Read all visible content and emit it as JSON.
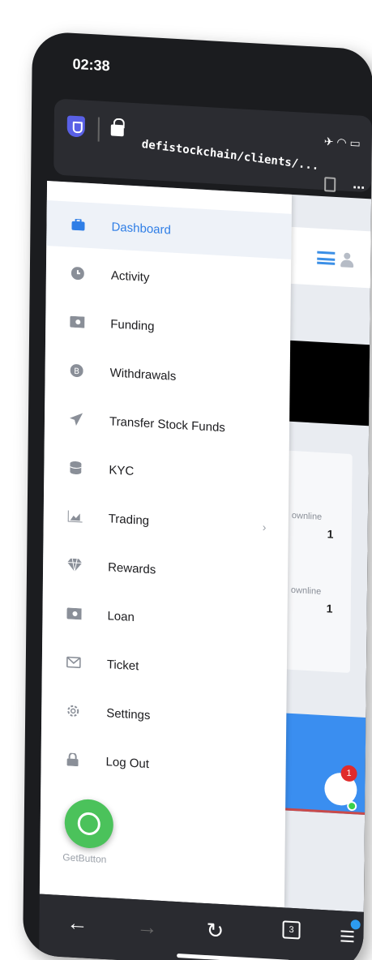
{
  "status_bar": {
    "time": "02:38",
    "icons": [
      "airplane-icon",
      "wifi-icon",
      "battery-icon"
    ]
  },
  "browser": {
    "url": "defistockchain/clients/...",
    "tabs_count": "3",
    "more_label": "..."
  },
  "drawer": {
    "items": [
      {
        "label": "Dashboard",
        "icon": "briefcase-icon",
        "active": true
      },
      {
        "label": "Activity",
        "icon": "clock-icon"
      },
      {
        "label": "Funding",
        "icon": "money-icon"
      },
      {
        "label": "Withdrawals",
        "icon": "bitcoin-icon"
      },
      {
        "label": "Transfer Stock Funds",
        "icon": "paper-plane-icon"
      },
      {
        "label": "KYC",
        "icon": "database-icon"
      },
      {
        "label": "Trading",
        "icon": "chart-area-icon",
        "chevron": "›"
      },
      {
        "label": "Rewards",
        "icon": "diamond-icon"
      },
      {
        "label": "Loan",
        "icon": "money-icon"
      },
      {
        "label": "Ticket",
        "icon": "envelope-icon"
      },
      {
        "label": "Settings",
        "icon": "gear-icon"
      },
      {
        "label": "Log Out",
        "icon": "lock-icon"
      }
    ]
  },
  "background_page": {
    "downline_label_1": "ownline",
    "downline_value_1": "1",
    "downline_label_2": "ownline",
    "downline_value_2": "1",
    "chat_badge": "1"
  },
  "widget": {
    "label": "GetButton"
  },
  "colors": {
    "accent": "#2f7ee6",
    "drawer_active_bg": "#eef2f8",
    "whatsapp": "#4bc25b",
    "toolbar": "#2a2b30"
  }
}
